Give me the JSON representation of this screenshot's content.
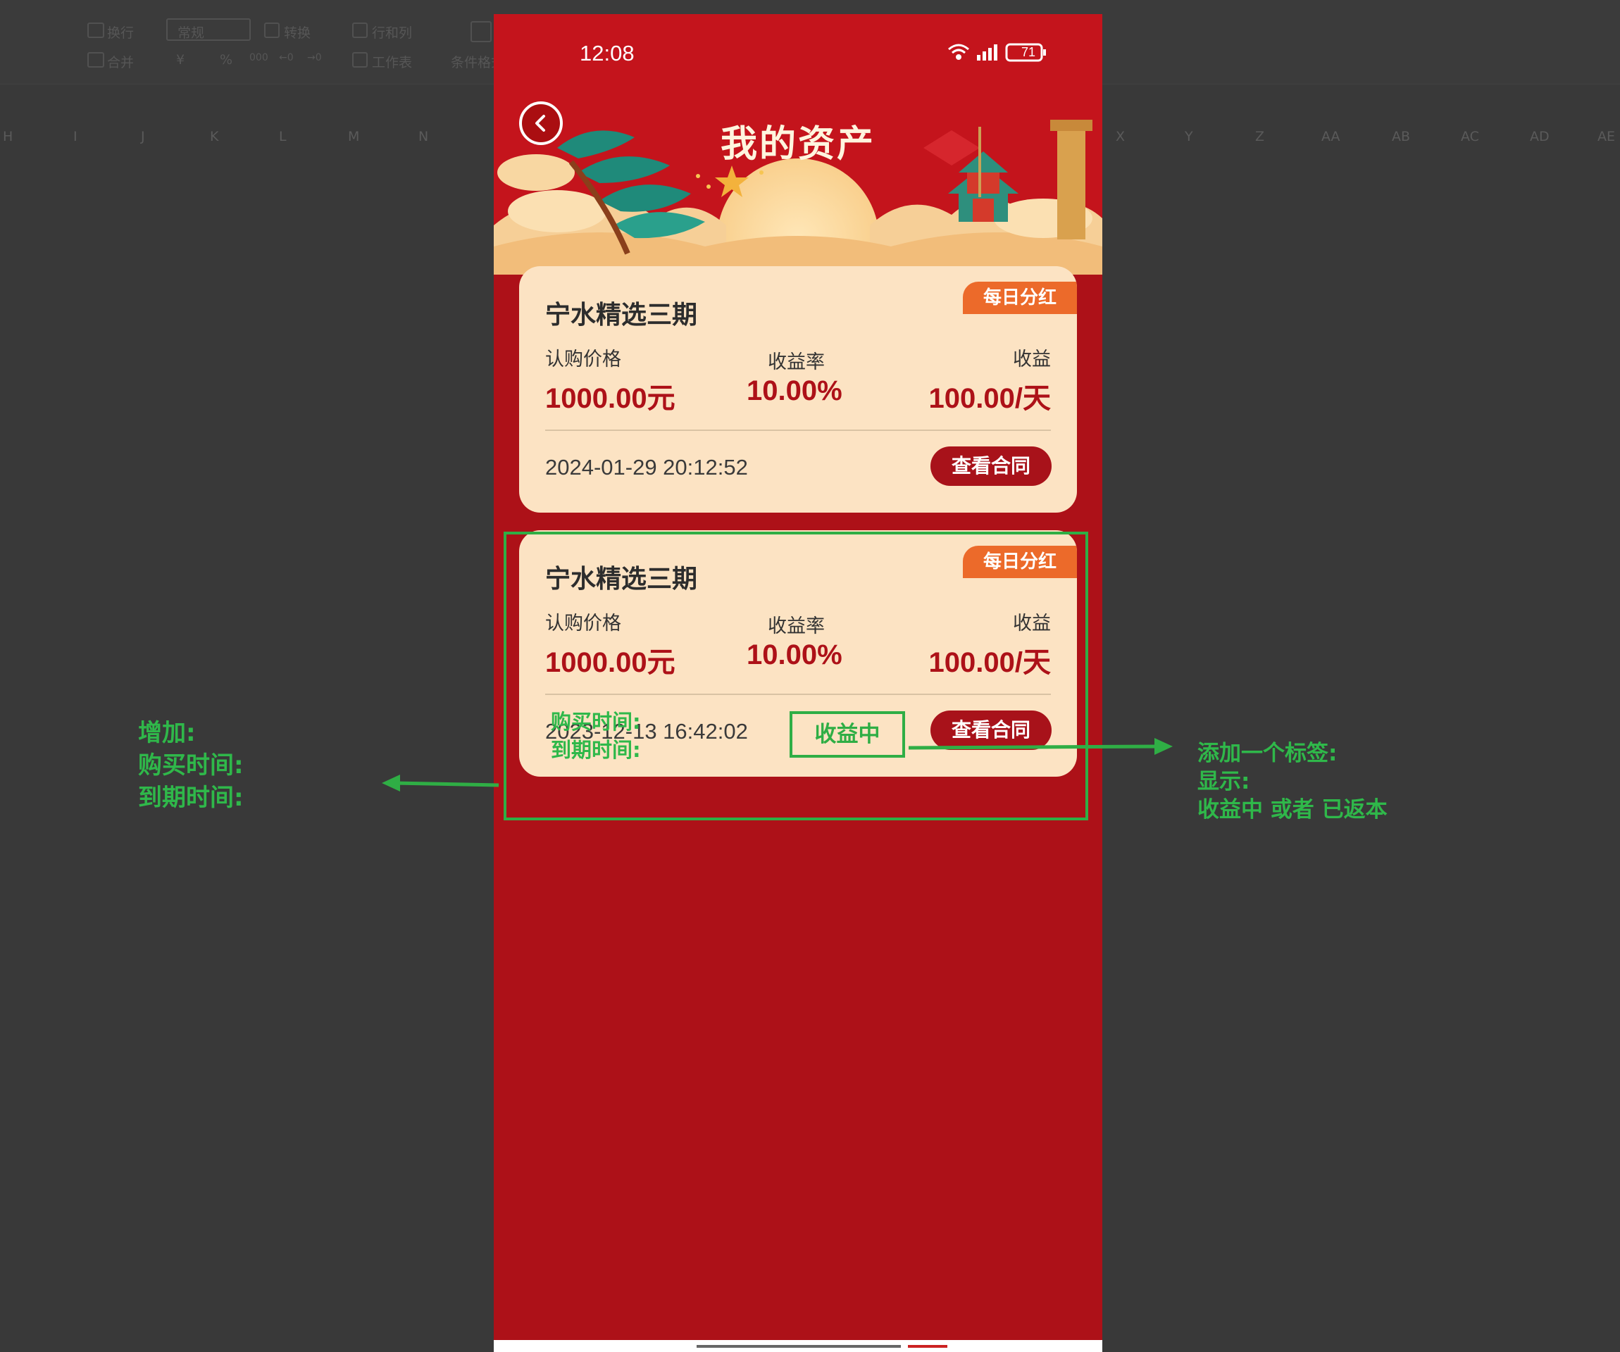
{
  "background": {
    "toolbar_labels": [
      "换行",
      "常规",
      "转换",
      "行和列",
      "合并",
      "工作表",
      "条件格式"
    ],
    "toolbar_symbols": [
      "¥",
      "%",
      "000",
      "←0",
      "→0"
    ],
    "columns": [
      "H",
      "I",
      "J",
      "K",
      "L",
      "M",
      "N",
      "X",
      "Y",
      "Z",
      "AA",
      "AB",
      "AC",
      "AD",
      "AE"
    ]
  },
  "status_bar": {
    "time": "12:08",
    "battery": "71"
  },
  "header": {
    "title": "我的资产"
  },
  "cards": [
    {
      "tag": "每日分红",
      "title": "宁水精选三期",
      "labels": {
        "price": "认购价格",
        "rate": "收益率",
        "income": "收益"
      },
      "values": {
        "price": "1000.00元",
        "rate": "10.00%",
        "income": "100.00/天"
      },
      "date": "2024-01-29 20:12:52",
      "button": "查看合同"
    },
    {
      "tag": "每日分红",
      "title": "宁水精选三期",
      "labels": {
        "price": "认购价格",
        "rate": "收益率",
        "income": "收益"
      },
      "values": {
        "price": "1000.00元",
        "rate": "10.00%",
        "income": "100.00/天"
      },
      "date": "2023-12-13 16:42:02",
      "button": "查看合同"
    }
  ],
  "annotations": {
    "inline_purchase": "购买时间:",
    "inline_expire": "到期时间:",
    "status_label": "收益中",
    "left_note": [
      "增加:",
      "购买时间:",
      "到期时间:"
    ],
    "right_note": [
      "添加一个标签:",
      "显示:",
      "收益中 或者 已返本"
    ],
    "color": "#2fae45"
  },
  "colors": {
    "app_red": "#ad1118",
    "card_bg": "#fce3c3",
    "tag_orange": "#ec6a2a",
    "value_red": "#ad1118"
  }
}
